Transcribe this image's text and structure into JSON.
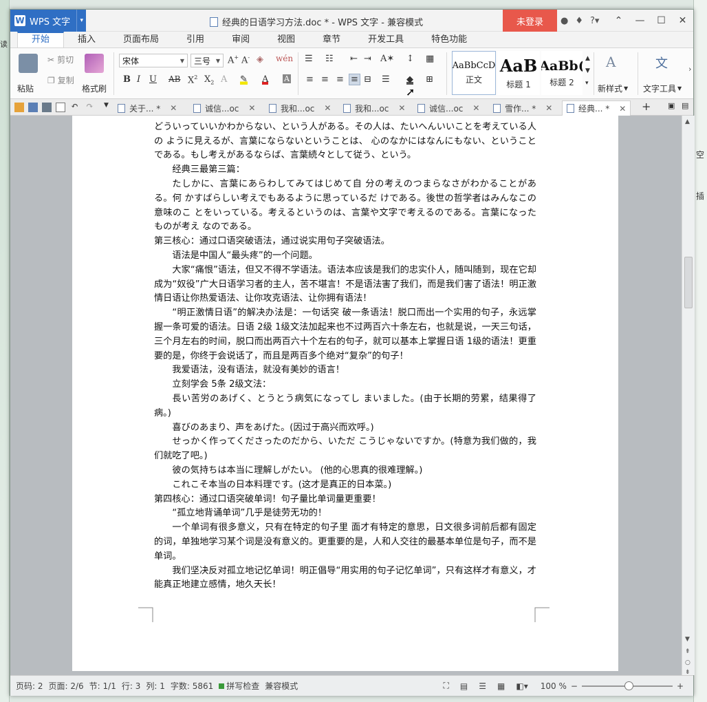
{
  "app": {
    "menu_label": "WPS 文字",
    "window_title": "经典的日语学习方法.doc * - WPS 文字 - 兼容模式",
    "login_label": "未登录"
  },
  "ribbon_tabs": [
    "开始",
    "插入",
    "页面布局",
    "引用",
    "审阅",
    "视图",
    "章节",
    "开发工具",
    "特色功能"
  ],
  "clipboard": {
    "paste": "粘贴",
    "cut": "剪切",
    "copy": "复制",
    "format_painter": "格式刷"
  },
  "font": {
    "name": "宋体",
    "size": "三号"
  },
  "styles": [
    {
      "sample": "AaBbCcD",
      "label": "正文"
    },
    {
      "sample": "AaB",
      "label": "标题 1"
    },
    {
      "sample": "AaBb(",
      "label": "标题 2"
    }
  ],
  "ribbon_right": {
    "new_style": "新样式",
    "text_tools": "文字工具"
  },
  "doc_tabs": [
    "关于... *",
    "诚信...oc",
    "我和...oc",
    "我和...oc",
    "诚信...oc",
    "雪作... *",
    "经典... *"
  ],
  "paragraphs": [
    {
      "text": "モンテーニュは、こういうことをいっている。世間にはよく、心では思っているのだけれど、どういっていいかわからない、という人がある。その人は、たいへんいいことを考えている人の ように見えるが、言葉にならないということは、 心のなかにはなんにもない、ということである。もし考えがあるならば、言葉続々として従う、という。",
      "indent": false
    },
    {
      "text": "经典三最第三篇：",
      "indent": true
    },
    {
      "text": "たしかに、言葉にあらわしてみてはじめて自 分の考えのつまらなさがわかることがある。何 かすばらしい考えでもあるように思っているだ けである。後世の哲学者はみんなこの意味のこ とをいっている。考えるというのは、言葉や文字で考えるのである。言葉になったものが考え なのである。",
      "indent": true
    },
    {
      "text": "第三核心：通过口语突破语法，通过说实用句子突破语法。",
      "indent": false
    },
    {
      "text": "语法是中国人“最头疼”的一个问题。",
      "indent": true
    },
    {
      "text": "大家“痛恨”语法，但又不得不学语法。语法本应该是我们的忠实仆人，随叫随到，现在它却成为“奴役”广大日语学习者的主人，苦不堪言！不是语法害了我们，而是我们害了语法！明正激情日语让你热爱语法、让你攻克语法、让你拥有语法！",
      "indent": true
    },
    {
      "text": "“明正激情日语”的解决办法是：一句话突 破一条语法！脱口而出一个实用的句子，永远掌握一条可爱的语法。日语 2级 1级文法加起来也不过两百六十条左右，也就是说，一天三句话，三个月左右的时间，脱口而出两百六十个左右的句子，就可以基本上掌握日语 1级的语法！更重要的是，你终于会说话了，而且是两百多个绝对“复杂”的句子！",
      "indent": true
    },
    {
      "text": "我爱语法，没有语法，就没有美妙的语言！",
      "indent": true
    },
    {
      "text": "立刻学会 5条 2级文法：",
      "indent": true
    },
    {
      "text": "長い苦労のあげく、とうとう病気になってし まいました。(由于长期的劳累，结果得了病。)",
      "indent": true
    },
    {
      "text": "喜びのあまり、声をあげた。(因过于高兴而欢呼。)",
      "indent": true
    },
    {
      "text": "せっかく作ってくださったのだから、いただ こうじゃないですか。(特意为我们做的，我们就吃了吧。)",
      "indent": true
    },
    {
      "text": "彼の気持ちは本当に理解しがたい。 (他的心思真的很难理解。)",
      "indent": true
    },
    {
      "text": "これこそ本当の日本料理です。(这才是真正的日本菜。)",
      "indent": true
    },
    {
      "text": "第四核心：通过口语突破单词！句子量比单词量更重要！",
      "indent": false
    },
    {
      "text": "“孤立地背诵单词”几乎是徒劳无功的！",
      "indent": true
    },
    {
      "text": "一个单词有很多意义，只有在特定的句子里 面才有特定的意思，日文很多词前后都有固定的词，单独地学习某个词是没有意义的。更重要的是，人和人交往的最基本单位是句子，而不是单词。",
      "indent": true
    },
    {
      "text": "我们坚决反对孤立地记忆单词！明正倡导“用实用的句子记忆单词”，只有这样才有意义，才能真正地建立感情，地久天长！",
      "indent": true
    }
  ],
  "status": {
    "page_code": "页码: 2",
    "page": "页面: 2/6",
    "section": "节: 1/1",
    "row": "行: 3",
    "col": "列: 1",
    "word_count": "字数: 5861",
    "spell_check": "拼写检查",
    "compat_mode": "兼容模式",
    "zoom": "100 %",
    "zoom_level": 1.0
  },
  "colors": {
    "accent": "#2f6fc4",
    "login": "#e8584b"
  }
}
